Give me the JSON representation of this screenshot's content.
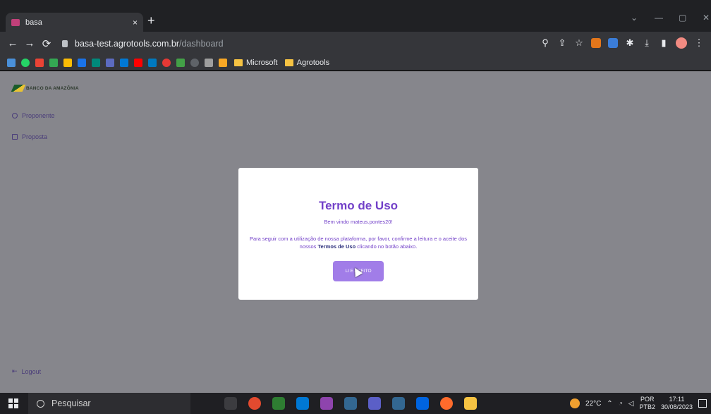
{
  "browser": {
    "tab_title": "basa",
    "tab_close": "×",
    "new_tab": "+",
    "url_host": "basa-test.agrotools.com.br",
    "url_path": "/dashboard",
    "window_controls": [
      "⌄",
      "—",
      "▢",
      "✕"
    ],
    "bookmark_folders": [
      "Microsoft",
      "Agrotools"
    ]
  },
  "app": {
    "logo_text": "BANCO DA AMAZÔNIA",
    "sidebar": [
      {
        "label": "Proponente",
        "icon": "circle-dot-icon"
      },
      {
        "label": "Proposta",
        "icon": "document-icon"
      }
    ],
    "logout_label": "Logout"
  },
  "modal": {
    "title": "Termo de Uso",
    "welcome": "Bem vindo mateus.pontes20!",
    "body_prefix": "Para seguir com a utilização de nossa plataforma, por favor, confirme a leitura e o aceite dos nossos",
    "body_link": "Termos de Uso",
    "body_suffix": "clicando no botão abaixo.",
    "accept_button": "LI E ACEITO"
  },
  "taskbar": {
    "search_placeholder": "Pesquisar",
    "temperature": "22°C",
    "lang_1": "POR",
    "lang_2": "PTB2",
    "time": "17:11",
    "date": "30/08/2023"
  },
  "colors": {
    "accent": "#7240c8",
    "button": "#a17de8",
    "overlay": "#86868c"
  }
}
